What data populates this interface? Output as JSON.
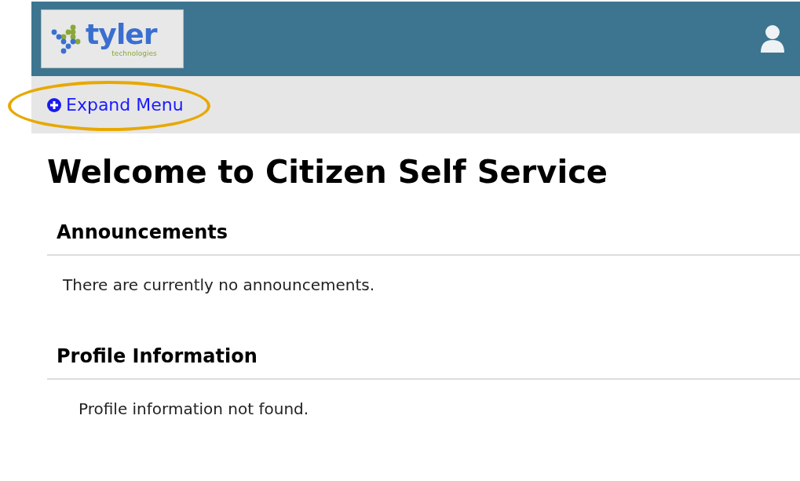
{
  "logo": {
    "name": "tyler",
    "tagline": "technologies"
  },
  "menu_toggle": {
    "label": "Expand Menu",
    "highlighted": true
  },
  "title": "Welcome to Citizen Self Service",
  "sections": [
    {
      "heading": "Announcements",
      "message": "There are currently no announcements."
    },
    {
      "heading": "Profile Information",
      "message": "Profile information not found."
    }
  ]
}
